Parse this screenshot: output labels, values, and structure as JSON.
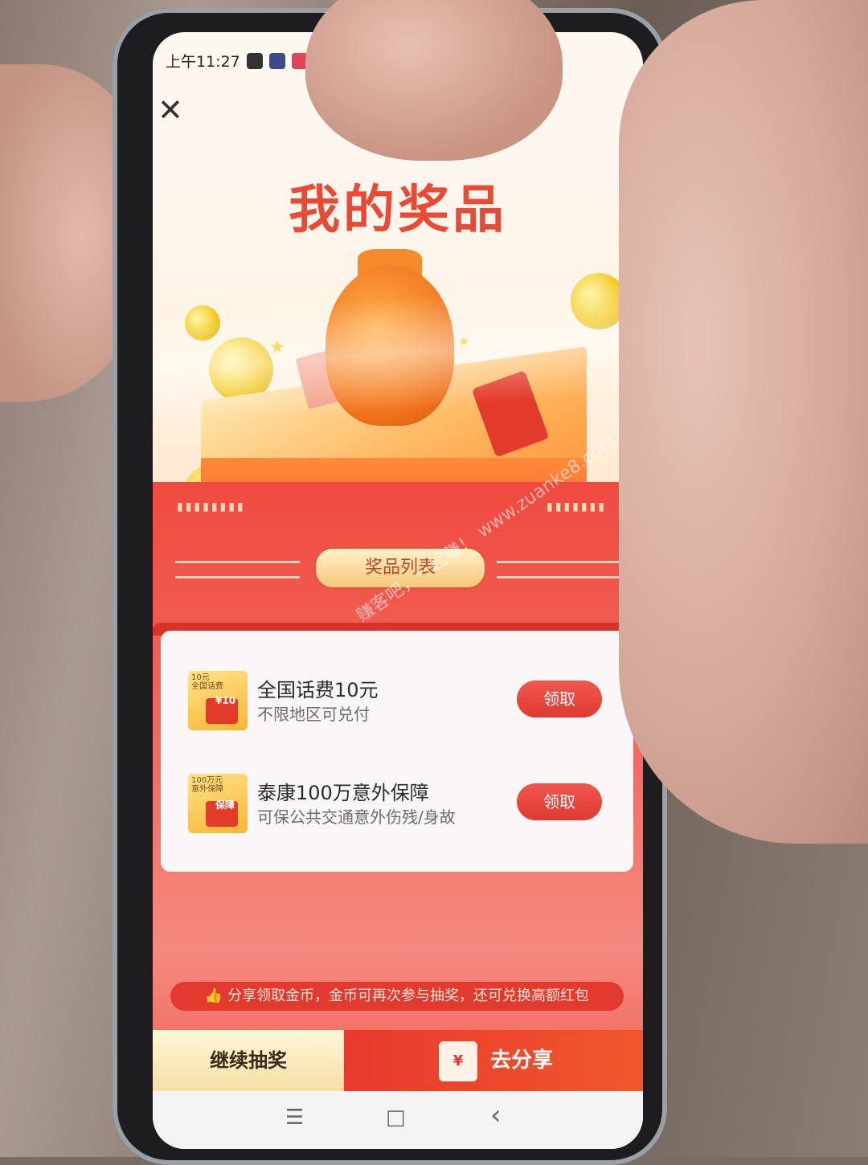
{
  "status_bar": {
    "time": "上午11:27"
  },
  "header": {
    "title": "我的奖品",
    "close_icon": "close-icon"
  },
  "hero": {
    "title": "我的奖品"
  },
  "list": {
    "title": "奖品列表",
    "items": [
      {
        "thumb_text": "10元\n全国话费",
        "thumb_badge": "¥10",
        "name": "全国话费10元",
        "desc": "不限地区可兑付",
        "button": "领取"
      },
      {
        "thumb_text": "100万元\n意外保障",
        "thumb_badge": "保障",
        "name": "泰康100万意外保障",
        "desc": "可保公共交通意外伤残/身故",
        "button": "领取"
      }
    ]
  },
  "tip": "分享领取金币，金币可再次参与抽奖，还可兑换高额红包",
  "bottom": {
    "continue_label": "继续抽奖",
    "share_label": "去分享",
    "share_icon_glyph": "¥"
  },
  "navbar": {
    "menu": "☰",
    "home": "□",
    "back": "‹"
  },
  "watermark": "赚客吧，一起赚！ www.zuanke8.com",
  "colors": {
    "brand_red": "#e23b2c",
    "gold": "#f3c920"
  }
}
